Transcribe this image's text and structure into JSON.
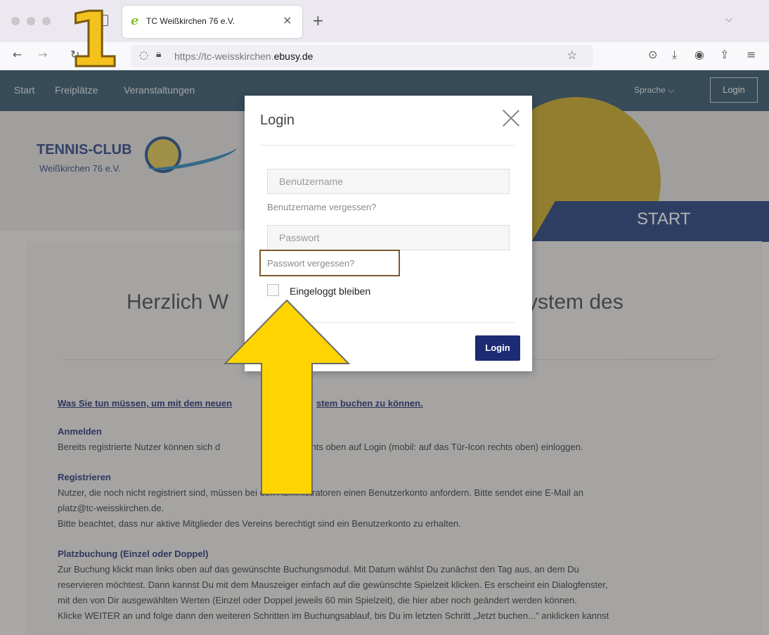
{
  "browser": {
    "tab_title": "TC Weißkirchen 76 e.V.",
    "tab_close": "×",
    "new_tab": "+",
    "tab_list": "⌵",
    "url_prefix": "https://tc-weisskirchen.",
    "url_domain": "ebusy.de"
  },
  "site": {
    "nav": [
      "Start",
      "Freiplätze",
      "Veranstaltungen"
    ],
    "language_label": "Sprache ⌵",
    "login_button": "Login",
    "club_name": "TENNIS-CLUB",
    "club_subtitle": "Weißkirchen 76 e.V.",
    "page_banner": "START",
    "welcome_left": "Herzlich W",
    "welcome_right": "ystem des",
    "intro_link_left": "Was Sie tun müssen, um mit dem neuen",
    "intro_link_right": "stem buchen zu können.",
    "sections": {
      "anmelden_title": "Anmelden",
      "anmelden_text_left": "Bereits registrierte Nutzer können sich d",
      "anmelden_text_right": "chts oben auf Login (mobil: auf das Tür-Icon rechts oben) einloggen.",
      "registrieren_title": "Registrieren",
      "registrieren_text_1": "Nutzer, die noch nicht registriert sind, müssen bei den Administratoren einen Benutzerkonto anfordern. Bitte sendet eine E-Mail an",
      "registrieren_text_2": "platz@tc-weisskirchen.de.",
      "registrieren_text_3": "Bitte beachtet, dass nur aktive Mitglieder des Vereins berechtigt sind ein Benutzerkonto zu erhalten.",
      "platz_title": "Platzbuchung (Einzel oder Doppel)",
      "platz_text_1": "Zur Buchung klickt man links oben auf das gewünschte Buchungsmodul. Mit Datum wählst Du zunächst den Tag aus, an dem Du",
      "platz_text_2": "reservieren möchtest. Dann kannst Du mit dem Mauszeiger einfach auf die gewünschte Spielzeit klicken. Es erscheint ein Dialogfenster,",
      "platz_text_3": "mit den von Dir ausgewählten Werten (Einzel oder Doppel jeweils 60 min Spielzeit), die hier aber noch geändert werden können.",
      "platz_text_4": "Klicke WEITER an und folge dann den weiteren  Schritten im Buchungsablauf, bis Du im letzten Schritt „Jetzt buchen...\" anklicken kannst"
    }
  },
  "modal": {
    "title": "Login",
    "username_placeholder": "Benutzername",
    "forgot_username": "Benutzername vergessen?",
    "password_placeholder": "Passwort",
    "forgot_password": "Passwort vergessen?",
    "remember_me": "Eingeloggt bleiben",
    "submit": "Login"
  },
  "annotation": {
    "step_number": "1",
    "arrow_color": "#ffd400",
    "badge_color": "#f4c21c"
  }
}
